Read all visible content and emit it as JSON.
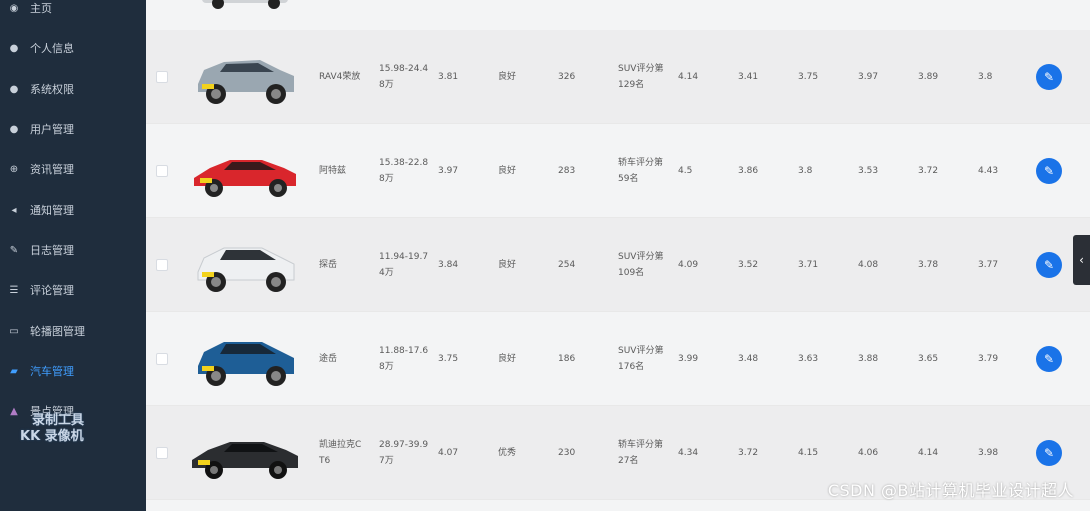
{
  "sidebar": {
    "items": [
      {
        "label": "主页",
        "icon": "dashboard-icon",
        "active": false
      },
      {
        "label": "个人信息",
        "icon": "user-icon",
        "active": false
      },
      {
        "label": "系统权限",
        "icon": "user-icon",
        "active": false
      },
      {
        "label": "用户管理",
        "icon": "users-icon",
        "active": false
      },
      {
        "label": "资讯管理",
        "icon": "globe-icon",
        "active": false
      },
      {
        "label": "通知管理",
        "icon": "bell-icon",
        "active": false
      },
      {
        "label": "日志管理",
        "icon": "feather-icon",
        "active": false
      },
      {
        "label": "评论管理",
        "icon": "list-icon",
        "active": false
      },
      {
        "label": "轮播图管理",
        "icon": "image-icon",
        "active": false
      },
      {
        "label": "汽车管理",
        "icon": "car-icon",
        "active": true
      },
      {
        "label": "景点管理",
        "icon": "location-icon",
        "active": false
      }
    ],
    "overlay_watermark": [
      "录制工具",
      "KK 录像机"
    ]
  },
  "table": {
    "rows": [
      {
        "name": "RAV4荣放",
        "price": [
          "15.98-24.4",
          "8万"
        ],
        "score": "3.81",
        "rating": "良好",
        "count": "326",
        "rank": [
          "SUV评分第",
          "129名"
        ],
        "s1": "4.14",
        "s2": "3.41",
        "s3": "3.75",
        "s4": "3.97",
        "s5": "3.89",
        "s6": "3.8",
        "car_color": "#9aa7b1"
      },
      {
        "name": "阿特兹",
        "price": [
          "15.38-22.8",
          "8万"
        ],
        "score": "3.97",
        "rating": "良好",
        "count": "283",
        "rank": [
          "轿车评分第",
          "59名"
        ],
        "s1": "4.5",
        "s2": "3.86",
        "s3": "3.8",
        "s4": "3.53",
        "s5": "3.72",
        "s6": "4.43",
        "car_color": "#d9262c"
      },
      {
        "name": "探岳",
        "price": [
          "11.94-19.7",
          "4万"
        ],
        "score": "3.84",
        "rating": "良好",
        "count": "254",
        "rank": [
          "SUV评分第",
          "109名"
        ],
        "s1": "4.09",
        "s2": "3.52",
        "s3": "3.71",
        "s4": "4.08",
        "s5": "3.78",
        "s6": "3.77",
        "car_color": "#eef0f2"
      },
      {
        "name": "途岳",
        "price": [
          "11.88-17.6",
          "8万"
        ],
        "score": "3.75",
        "rating": "良好",
        "count": "186",
        "rank": [
          "SUV评分第",
          "176名"
        ],
        "s1": "3.99",
        "s2": "3.48",
        "s3": "3.63",
        "s4": "3.88",
        "s5": "3.65",
        "s6": "3.79",
        "car_color": "#1e5e96"
      },
      {
        "name": "凯迪拉克C",
        "name2": "T6",
        "price": [
          "28.97-39.9",
          "7万"
        ],
        "score": "4.07",
        "rating": "优秀",
        "count": "230",
        "rank": [
          "轿车评分第",
          "27名"
        ],
        "s1": "4.34",
        "s2": "3.72",
        "s3": "4.15",
        "s4": "4.06",
        "s5": "4.14",
        "s6": "3.98",
        "car_color": "#2b2d30"
      }
    ]
  },
  "footer_watermark": "CSDN @B站计算机毕业设计超人"
}
